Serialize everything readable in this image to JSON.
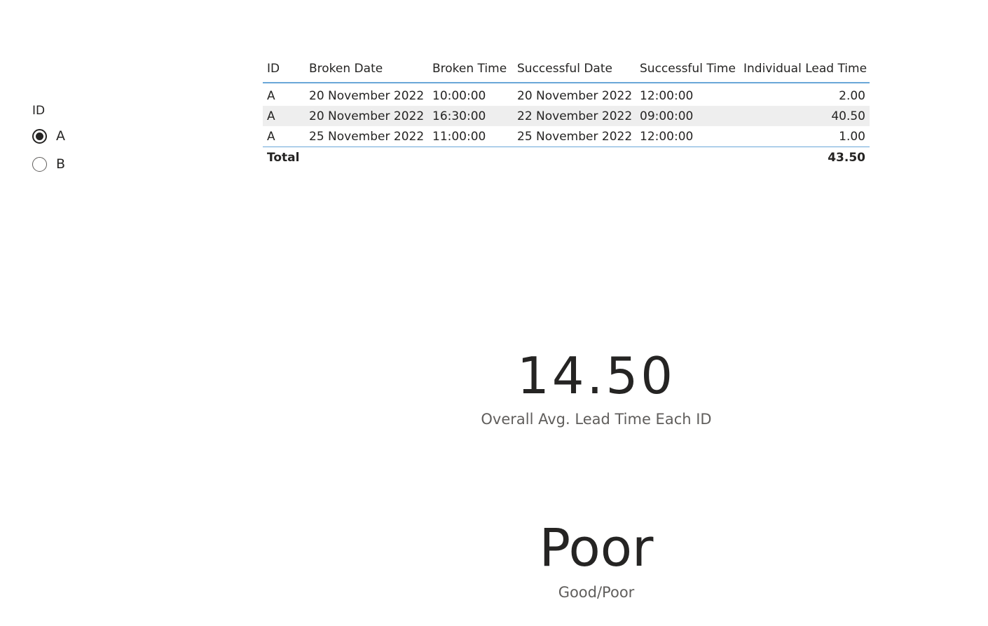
{
  "slicer": {
    "title": "ID",
    "options": [
      {
        "label": "A",
        "selected": true
      },
      {
        "label": "B",
        "selected": false
      }
    ]
  },
  "table": {
    "columns": [
      "ID",
      "Broken Date",
      "Broken Time",
      "Successful Date",
      "Successful Time",
      "Individual Lead Time"
    ],
    "rows": [
      [
        "A",
        "20 November 2022",
        "10:00:00",
        "20 November 2022",
        "12:00:00",
        "2.00"
      ],
      [
        "A",
        "20 November 2022",
        "16:30:00",
        "22 November 2022",
        "09:00:00",
        "40.50"
      ],
      [
        "A",
        "25 November 2022",
        "11:00:00",
        "25 November 2022",
        "12:00:00",
        "1.00"
      ]
    ],
    "total_label": "Total",
    "total_value": "43.50",
    "colors": {
      "header_border": "#6aa7d8",
      "alt_row": "#eeeeee"
    }
  },
  "cards": {
    "avg_lead_time": {
      "value": "14.50",
      "label": "Overall Avg. Lead Time Each ID"
    },
    "good_poor": {
      "value": "Poor",
      "label": "Good/Poor"
    }
  }
}
